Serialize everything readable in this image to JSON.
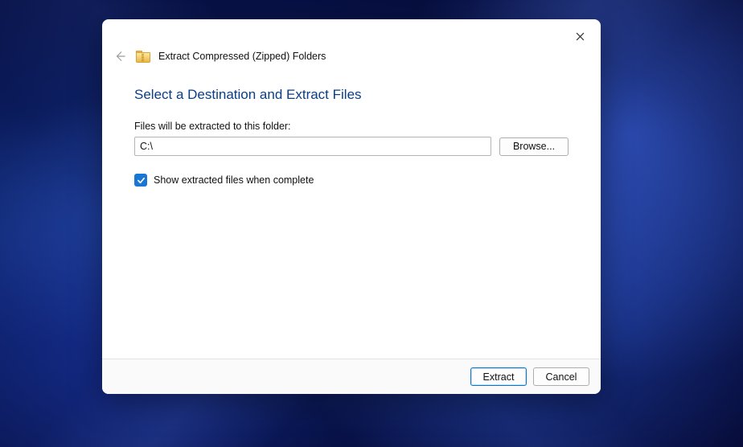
{
  "dialog": {
    "wizard_title": "Extract Compressed (Zipped) Folders",
    "heading": "Select a Destination and Extract Files",
    "path_label": "Files will be extracted to this folder:",
    "path_value": "C:\\",
    "browse_label": "Browse...",
    "show_extracted_checked": true,
    "show_extracted_label": "Show extracted files when complete",
    "extract_label": "Extract",
    "cancel_label": "Cancel"
  }
}
